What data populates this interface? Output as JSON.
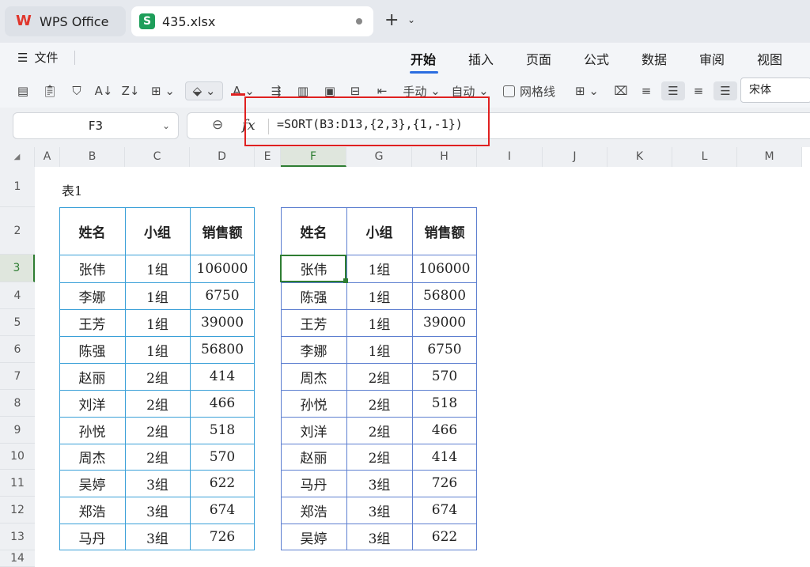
{
  "titlebar": {
    "app_tab": "WPS Office",
    "file_tab": "435.xlsx",
    "new_tab": "+"
  },
  "menu": {
    "file": "文件",
    "tabs": [
      "开始",
      "插入",
      "页面",
      "公式",
      "数据",
      "审阅",
      "视图"
    ],
    "active_tab": "开始"
  },
  "toolbar": {
    "manual_label": "手动",
    "auto_label": "自动",
    "gridlines_label": "网格线",
    "font_name": "宋体"
  },
  "formula_bar": {
    "cell_ref": "F3",
    "fx": "fx",
    "formula": "=SORT(B3:D13,{2,3},{1,-1})"
  },
  "sheet": {
    "columns": [
      "A",
      "B",
      "C",
      "D",
      "E",
      "F",
      "G",
      "H",
      "I",
      "J",
      "K",
      "L",
      "M"
    ],
    "rows": [
      "1",
      "2",
      "3",
      "4",
      "5",
      "6",
      "7",
      "8",
      "9",
      "10",
      "11",
      "12",
      "13",
      "14"
    ],
    "active_column": "F",
    "active_row": "3",
    "caption": "表1",
    "headers": [
      "姓名",
      "小组",
      "销售额"
    ],
    "left_table": [
      [
        "张伟",
        "1组",
        "106000"
      ],
      [
        "李娜",
        "1组",
        "6750"
      ],
      [
        "王芳",
        "1组",
        "39000"
      ],
      [
        "陈强",
        "1组",
        "56800"
      ],
      [
        "赵丽",
        "2组",
        "414"
      ],
      [
        "刘洋",
        "2组",
        "466"
      ],
      [
        "孙悦",
        "2组",
        "518"
      ],
      [
        "周杰",
        "2组",
        "570"
      ],
      [
        "吴婷",
        "3组",
        "622"
      ],
      [
        "郑浩",
        "3组",
        "674"
      ],
      [
        "马丹",
        "3组",
        "726"
      ]
    ],
    "right_table": [
      [
        "张伟",
        "1组",
        "106000"
      ],
      [
        "陈强",
        "1组",
        "56800"
      ],
      [
        "王芳",
        "1组",
        "39000"
      ],
      [
        "李娜",
        "1组",
        "6750"
      ],
      [
        "周杰",
        "2组",
        "570"
      ],
      [
        "孙悦",
        "2组",
        "518"
      ],
      [
        "刘洋",
        "2组",
        "466"
      ],
      [
        "赵丽",
        "2组",
        "414"
      ],
      [
        "马丹",
        "3组",
        "726"
      ],
      [
        "郑浩",
        "3组",
        "674"
      ],
      [
        "吴婷",
        "3组",
        "622"
      ]
    ]
  },
  "colors": {
    "accent": "#2b6de0",
    "selection": "#2e7d32",
    "annotation": "#e02020",
    "table_border": "#3aa0d8"
  }
}
